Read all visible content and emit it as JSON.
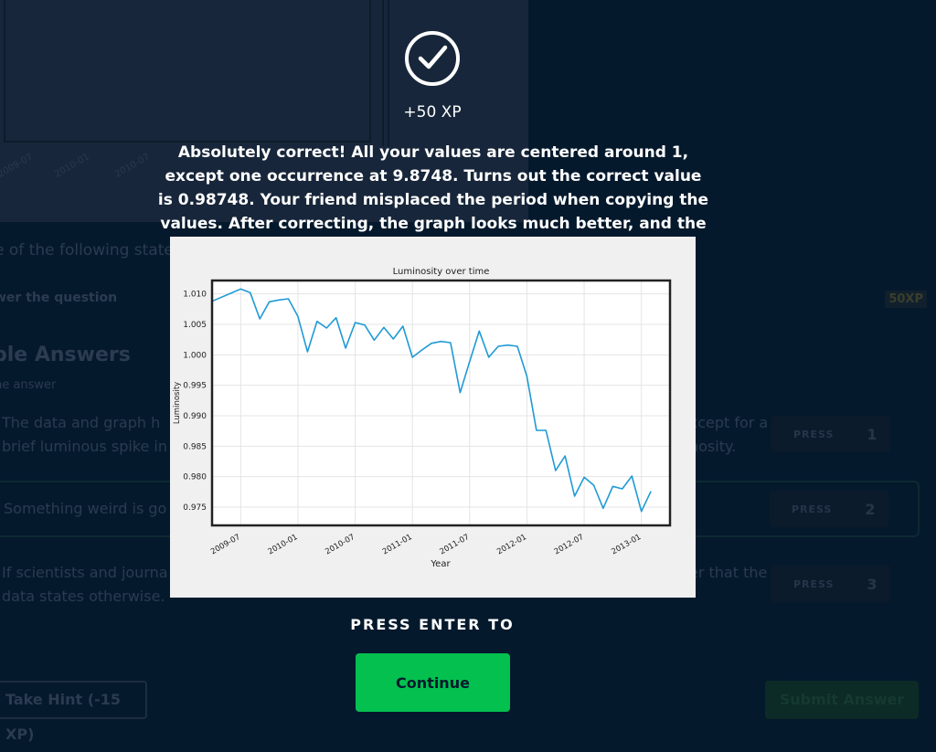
{
  "modal": {
    "xp": "+50 XP",
    "message": "Absolutely correct! All your values are centered around 1, except one occurrence at 9.8748. Turns out the correct value is 0.98748. Your friend misplaced the period when copying the values. After correcting, the graph looks much better, and the star is indeed dimming.",
    "press_enter": "PRESS ENTER TO",
    "continue_label": "Continue",
    "check_icon": "check-circle-icon",
    "accent_color": "#03c04f",
    "background_color": "#05192d"
  },
  "background": {
    "question": "e of the following state",
    "answer_prompt": "wer the question",
    "xp_badge": "50XP",
    "answers_heading": "ble Answers",
    "answers_sub": "ne answer",
    "options": [
      {
        "text_left": "The data and graph h",
        "text_left_2": "brief luminous spike in",
        "text_right": "xcept for a",
        "text_right_2": "nosity.",
        "press": "PRESS",
        "key": "1"
      },
      {
        "text_left": "Something weird is go",
        "press": "PRESS",
        "key": "2"
      },
      {
        "text_left": "If scientists and journa",
        "text_left_2": "data states otherwise.",
        "text_right": "er that the",
        "press": "PRESS",
        "key": "3"
      }
    ],
    "hint_button": "Take Hint (-15 XP)",
    "submit_button": "Submit Answer",
    "plot_ticks": [
      "2009-07",
      "2010-01",
      "2010-07"
    ]
  },
  "chart_data": {
    "type": "line",
    "title": "Luminosity over time",
    "xlabel": "Year",
    "ylabel": "Luminosity",
    "ylim": [
      0.972,
      1.0122
    ],
    "xlim": [
      "2009-04",
      "2013-04"
    ],
    "x_ticks": [
      "2009-07",
      "2010-01",
      "2010-07",
      "2011-01",
      "2011-07",
      "2012-01",
      "2012-07",
      "2013-01"
    ],
    "y_ticks": [
      0.975,
      0.98,
      0.985,
      0.99,
      0.995,
      1.0,
      1.005,
      1.01
    ],
    "y_tick_labels": [
      "0.975",
      "0.980",
      "0.985",
      "0.990",
      "0.995",
      "1.000",
      "1.005",
      "1.010"
    ],
    "grid": true,
    "color": "#1f9ad6",
    "x": [
      "2009-04",
      "2009-07",
      "2009-08",
      "2009-09",
      "2009-10",
      "2009-11",
      "2009-12",
      "2010-01",
      "2010-02",
      "2010-03",
      "2010-04",
      "2010-05",
      "2010-06",
      "2010-07",
      "2010-08",
      "2010-09",
      "2010-10",
      "2010-11",
      "2010-12",
      "2011-01",
      "2011-02",
      "2011-03",
      "2011-04",
      "2011-05",
      "2011-06",
      "2011-07",
      "2011-08",
      "2011-09",
      "2011-10",
      "2011-11",
      "2011-12",
      "2012-01",
      "2012-02",
      "2012-03",
      "2012-04",
      "2012-05",
      "2012-06",
      "2012-07",
      "2012-08",
      "2012-09",
      "2012-10",
      "2012-11",
      "2012-12",
      "2013-01",
      "2013-02",
      "2013-03",
      "2013-04"
    ],
    "y": [
      1.0088,
      1.0108,
      1.0102,
      1.0059,
      1.0087,
      1.009,
      1.0092,
      1.0063,
      1.0005,
      1.0055,
      1.0044,
      1.0061,
      1.0011,
      1.0053,
      1.0049,
      1.0024,
      1.0045,
      1.0026,
      1.0047,
      0.9996,
      1.0008,
      1.0019,
      1.0022,
      1.002,
      0.9938,
      0.9989,
      1.0039,
      0.9996,
      1.0014,
      1.0016,
      1.0014,
      0.9965,
      0.9876,
      0.9876,
      0.981,
      0.9834,
      0.9768,
      0.9799,
      0.9786,
      0.9748,
      0.9784,
      0.978,
      0.9801,
      0.9743,
      0.9776
    ]
  }
}
